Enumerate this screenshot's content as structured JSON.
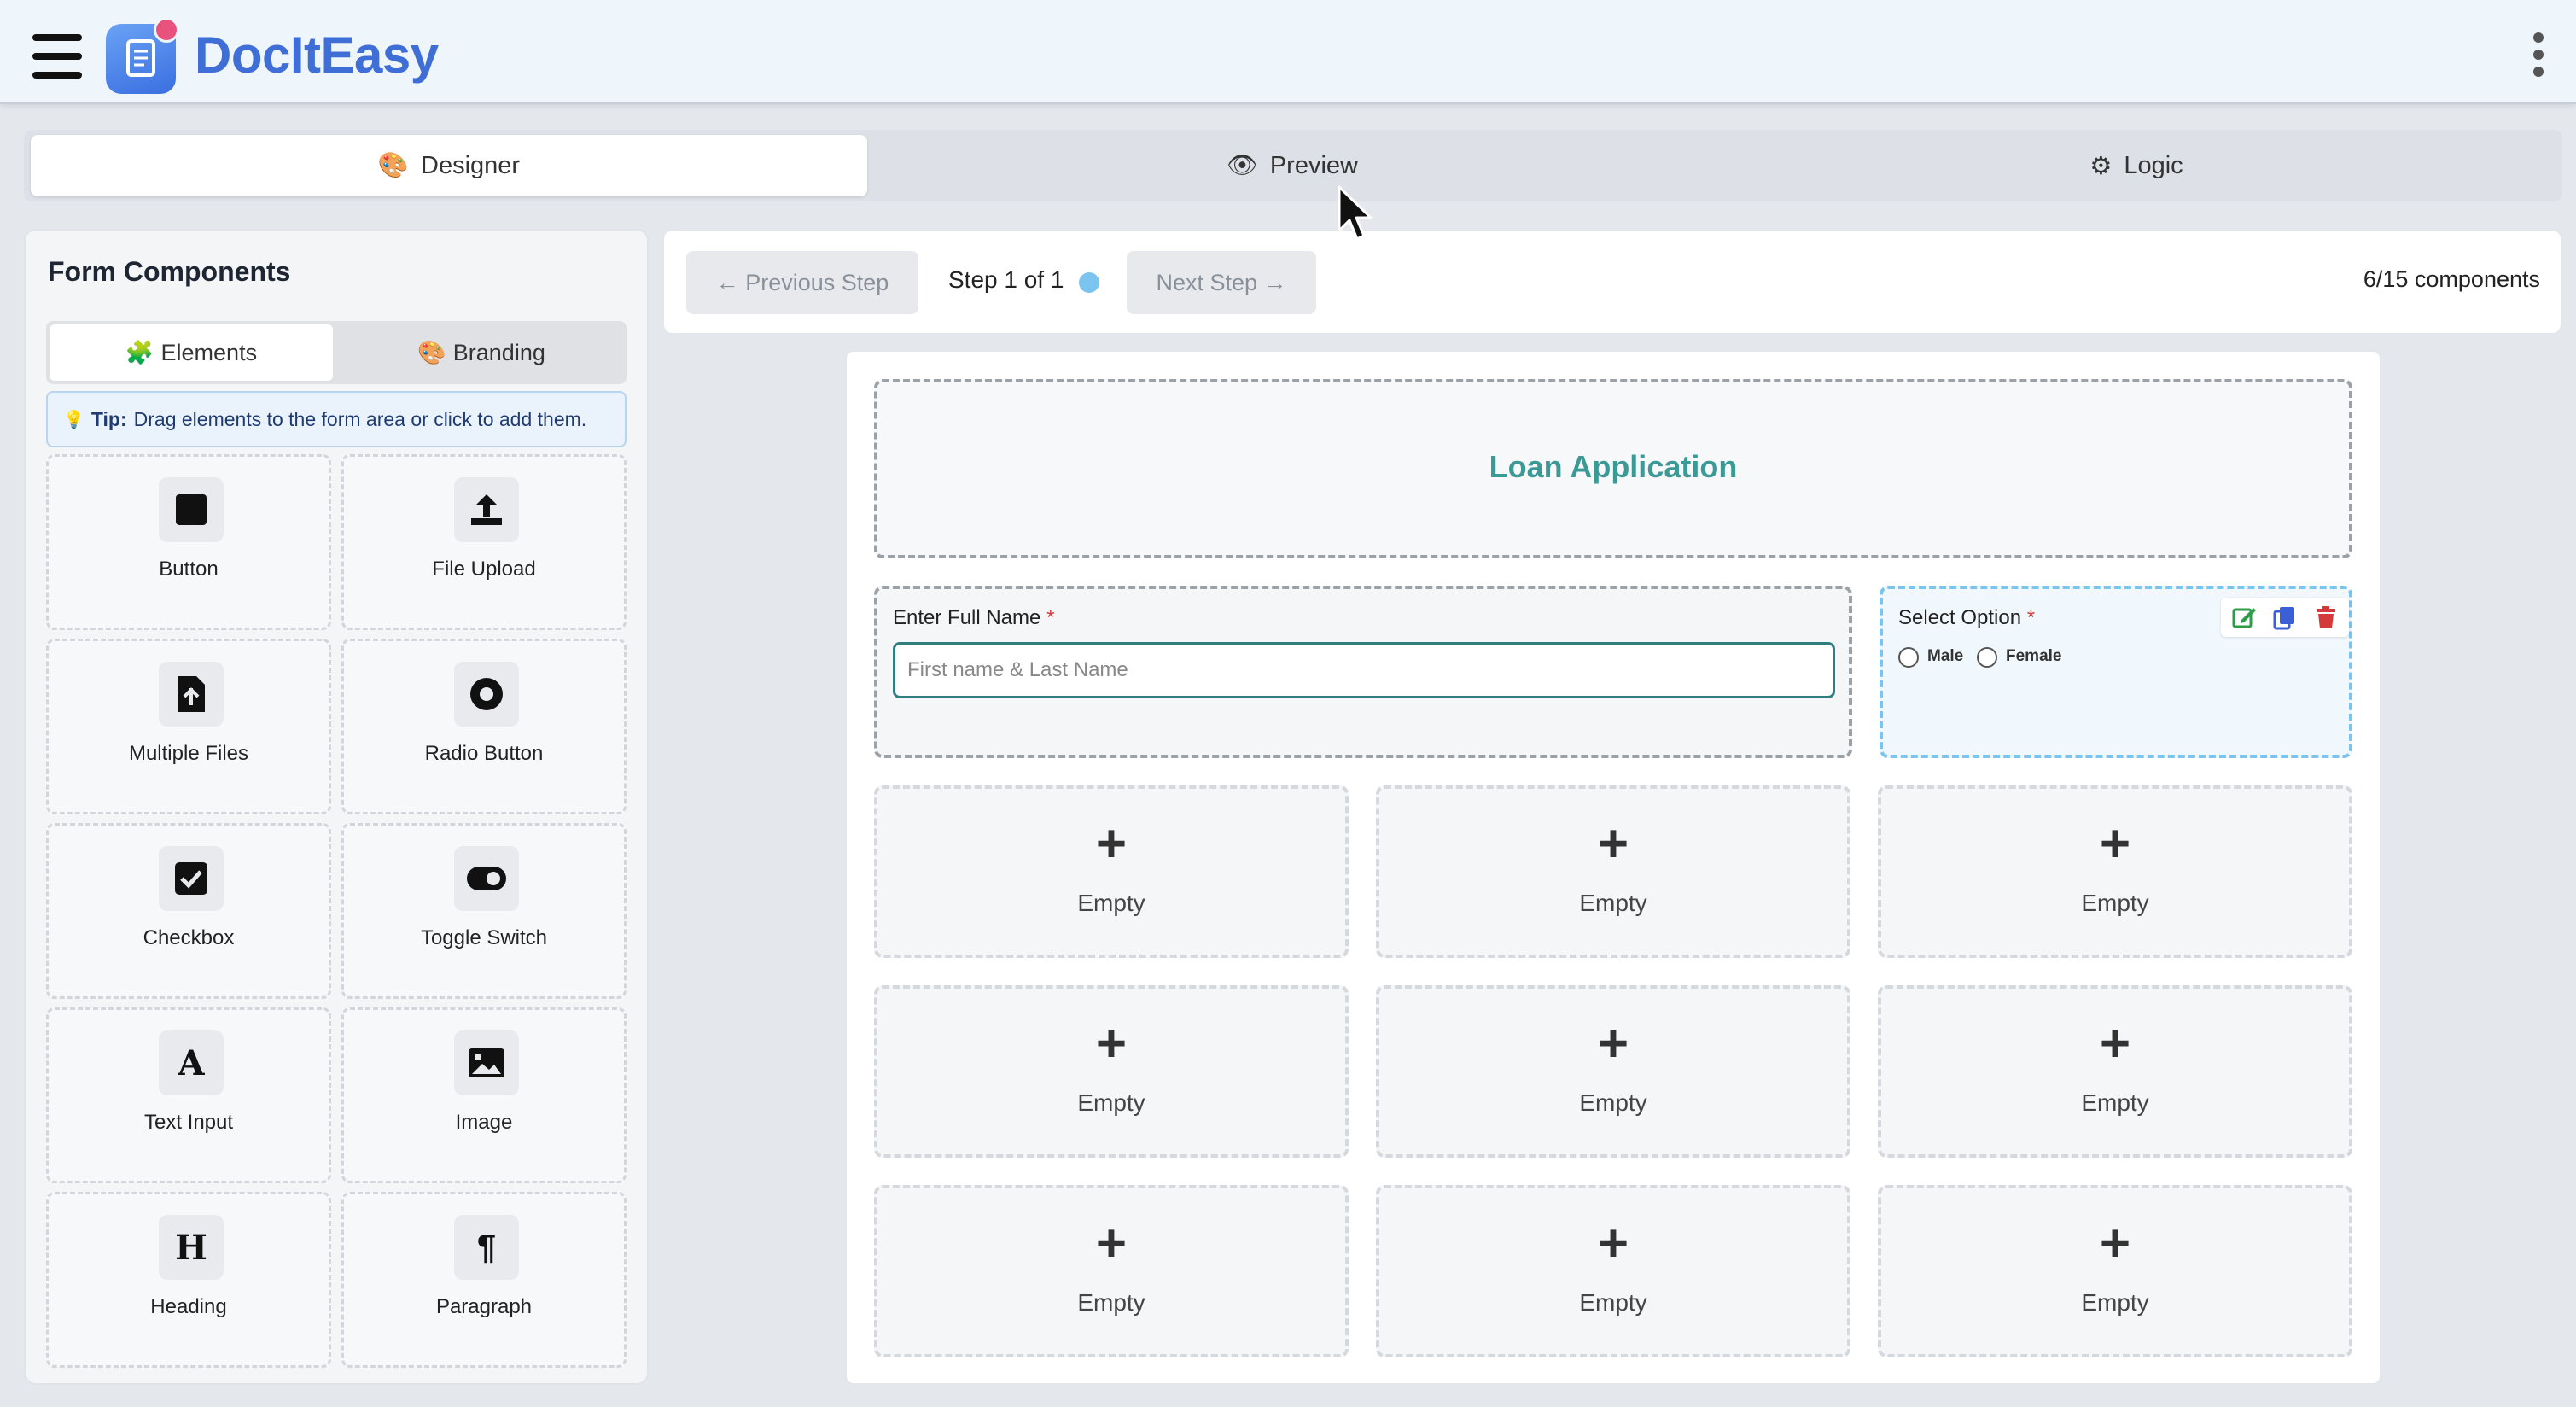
{
  "app": {
    "title": "DocItEasy"
  },
  "icons": {
    "menu": "hamburger-icon",
    "logo": "document-icon",
    "more": "more-vertical-icon"
  },
  "top_tabs": [
    {
      "label": "Designer",
      "icon": "palette-icon",
      "active": true
    },
    {
      "label": "Preview",
      "icon": "eye-icon",
      "active": false
    },
    {
      "label": "Logic",
      "icon": "gear-icon",
      "active": false
    }
  ],
  "panel": {
    "title": "Form Components",
    "tabs": [
      {
        "label": "Elements",
        "icon": "puzzle-icon",
        "active": true
      },
      {
        "label": "Branding",
        "icon": "palette-icon",
        "active": false
      }
    ],
    "tip": {
      "prefix": "Tip:",
      "text": "Drag elements to the form area or click to add them."
    },
    "components": [
      {
        "label": "Button",
        "icon": "square-icon"
      },
      {
        "label": "File Upload",
        "icon": "upload-icon"
      },
      {
        "label": "Multiple Files",
        "icon": "file-plus-icon"
      },
      {
        "label": "Radio Button",
        "icon": "radio-icon"
      },
      {
        "label": "Checkbox",
        "icon": "checkbox-icon"
      },
      {
        "label": "Toggle Switch",
        "icon": "toggle-icon"
      },
      {
        "label": "Text Input",
        "icon": "letter-a-icon"
      },
      {
        "label": "Image",
        "icon": "image-icon"
      },
      {
        "label": "Heading",
        "icon": "letter-h-icon"
      },
      {
        "label": "Paragraph",
        "icon": "pilcrow-icon"
      }
    ]
  },
  "stepper": {
    "prev_label": "← Previous Step",
    "step_label": "Step 1 of 1",
    "next_label": "Next Step →",
    "component_count": "6/15 components"
  },
  "form": {
    "heading": "Loan Application",
    "name_field": {
      "label": "Enter Full Name",
      "required_mark": "*",
      "placeholder": "First name & Last Name",
      "value": ""
    },
    "select_field": {
      "label": "Select Option",
      "required_mark": "*",
      "options": [
        "Male",
        "Female"
      ]
    },
    "empty_slot": {
      "label": "Empty",
      "plus": "+"
    }
  },
  "colors": {
    "accent": "#3f6fd6",
    "heading": "#3c9a96",
    "required": "#d43a3a",
    "selected_outline": "#7cc4f0"
  }
}
